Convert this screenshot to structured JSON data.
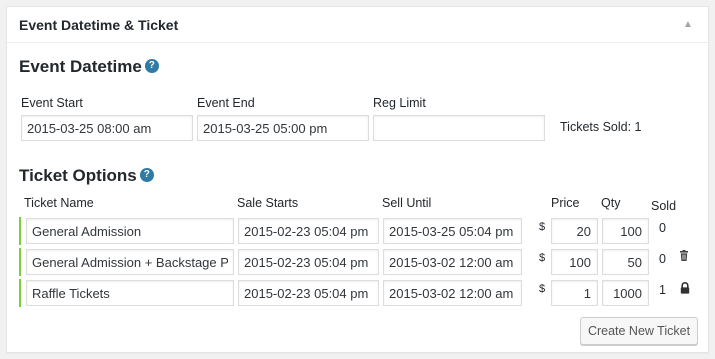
{
  "panel": {
    "title": "Event Datetime & Ticket"
  },
  "event_datetime": {
    "heading": "Event Datetime",
    "help_icon": "?",
    "start_label": "Event Start",
    "start_value": "2015-03-25 08:00 am",
    "end_label": "Event End",
    "end_value": "2015-03-25 05:00 pm",
    "reg_limit_label": "Reg Limit",
    "reg_limit_value": "",
    "tickets_sold": "Tickets Sold: 1"
  },
  "ticket_options": {
    "heading": "Ticket Options",
    "help_icon": "?",
    "columns": {
      "name": "Ticket Name",
      "sale_starts": "Sale Starts",
      "sell_until": "Sell Until",
      "price": "Price",
      "qty": "Qty",
      "sold": "Sold"
    },
    "currency_symbol": "$",
    "rows": [
      {
        "name": "General Admission",
        "sale_starts": "2015-02-23 05:04 pm",
        "sell_until": "2015-03-25 05:04 pm",
        "price": "20",
        "qty": "100",
        "sold": "0",
        "action_icon": "none"
      },
      {
        "name": "General Admission + Backstage Pass",
        "sale_starts": "2015-02-23 05:04 pm",
        "sell_until": "2015-03-02 12:00 am",
        "price": "100",
        "qty": "50",
        "sold": "0",
        "action_icon": "trash-icon"
      },
      {
        "name": "Raffle Tickets",
        "sale_starts": "2015-02-23 05:04 pm",
        "sell_until": "2015-03-02 12:00 am",
        "price": "1",
        "qty": "1000",
        "sold": "1",
        "action_icon": "lock-icon"
      }
    ],
    "create_button": "Create New Ticket"
  },
  "colors": {
    "accent_blue": "#2e7ba5",
    "row_marker_green": "#7ad03a"
  }
}
